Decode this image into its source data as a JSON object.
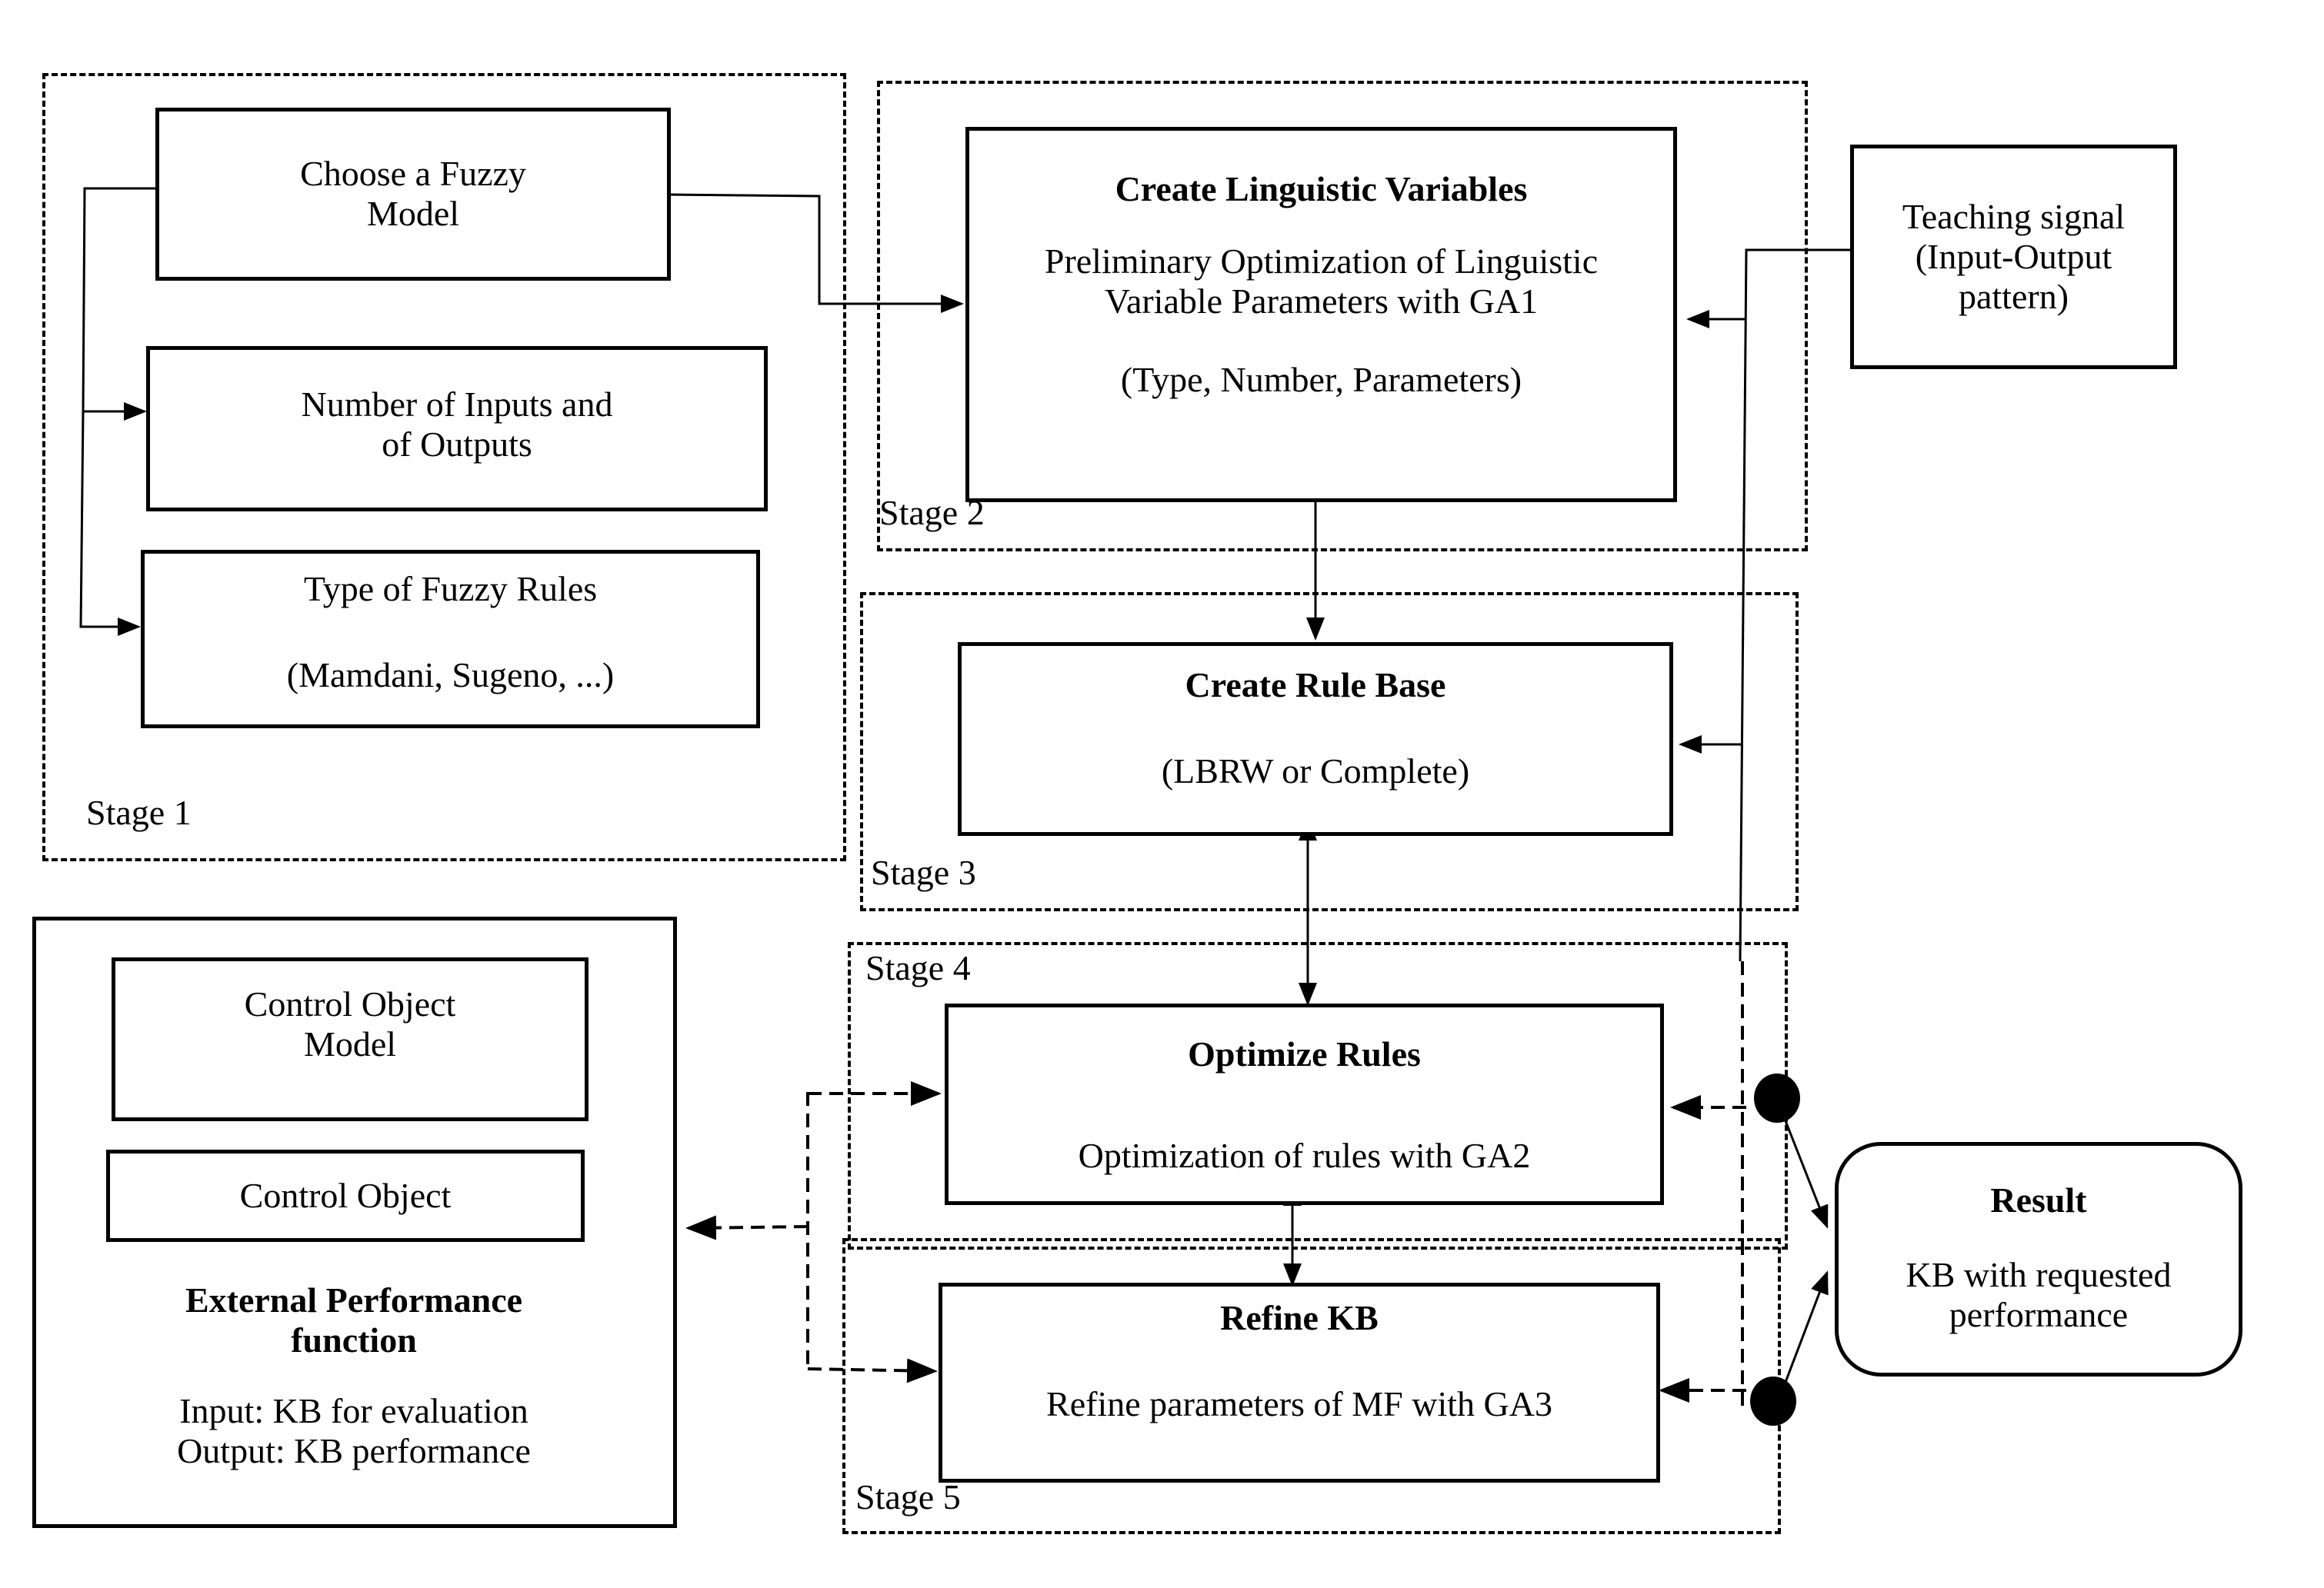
{
  "stage1": {
    "label": "Stage 1",
    "choose_model": {
      "line1": "Choose a Fuzzy",
      "line2": "Model"
    },
    "num_io": {
      "line1": "Number of Inputs  and",
      "line2": "of Outputs"
    },
    "rule_type": {
      "title": "Type of Fuzzy Rules",
      "detail": "(Mamdani, Sugeno, ...)"
    }
  },
  "stage2": {
    "label": "Stage 2",
    "title": "Create  Linguistic Variables",
    "line1": "Preliminary Optimization of Linguistic",
    "line2": "Variable Parameters with GA1",
    "detail": "(Type, Number, Parameters)"
  },
  "stage3": {
    "label": "Stage 3",
    "title": "Create Rule Base",
    "detail": "(LBRW or Complete)"
  },
  "stage4": {
    "label": "Stage 4",
    "title": "Optimize Rules",
    "detail": "Optimization of rules with GA2"
  },
  "stage5": {
    "label": "Stage 5",
    "title": "Refine KB",
    "detail": "Refine parameters of MF with GA3"
  },
  "teaching": {
    "line1": "Teaching signal",
    "line2": "(Input-Output",
    "line3": "pattern)"
  },
  "result": {
    "title": "Result",
    "line1": "KB with requested",
    "line2": "performance"
  },
  "external": {
    "model": {
      "line1": "Control Object",
      "line2": "Model"
    },
    "object": "Control Object",
    "title1": "External Performance",
    "title2": "function",
    "input": "Input: KB for evaluation",
    "output": "Output: KB performance"
  }
}
